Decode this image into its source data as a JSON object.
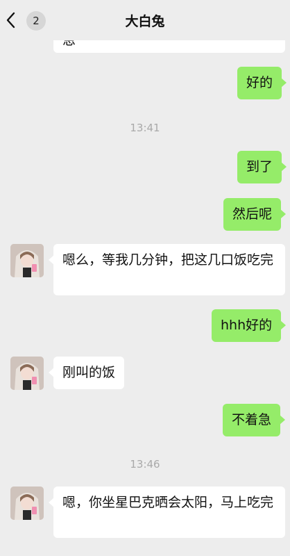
{
  "header": {
    "title": "大白兔",
    "unread_count": "2",
    "back_icon": "chevron-left-icon"
  },
  "messages": [
    {
      "type": "incoming",
      "text": "恩"
    },
    {
      "type": "outgoing",
      "text": "好的"
    },
    {
      "type": "time",
      "text": "13:41"
    },
    {
      "type": "outgoing",
      "text": "到了"
    },
    {
      "type": "outgoing",
      "text": "然后呢"
    },
    {
      "type": "incoming",
      "text": "嗯么，等我几分钟，把这几口饭吃完"
    },
    {
      "type": "outgoing",
      "text": "hhh好的"
    },
    {
      "type": "incoming",
      "text": "刚叫的饭"
    },
    {
      "type": "outgoing",
      "text": "不着急"
    },
    {
      "type": "time",
      "text": "13:46"
    },
    {
      "type": "incoming",
      "text": "嗯，你坐星巴克晒会太阳，马上吃完"
    }
  ],
  "colors": {
    "outgoing_bubble": "#95ec69",
    "incoming_bubble": "#ffffff",
    "background": "#ededed",
    "timestamp": "#a9a9a9"
  }
}
